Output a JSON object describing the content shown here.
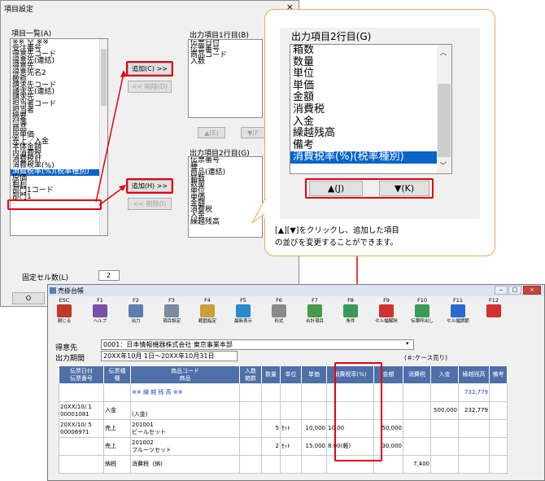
{
  "dialog": {
    "title": "項目設定",
    "close": "×",
    "item_list_label": "項目一覧(A)",
    "item_list": [
      "※※ 空 ※※",
      "受注番号",
      "得意先コード",
      "得意先(連結)",
      "得意先",
      "得意先名2",
      "敬称",
      "請求先コード",
      "請求先(連結)",
      "請求先",
      "担当者コード",
      "担当者",
      "摘要",
      "付箋",
      "商品",
      "原単価",
      "売上／入金",
      "本体金額",
      "内消費税",
      "消費税計",
      "消費税率(%)",
      "消費税率(%)(税率種別)",
      "原価",
      "粗利",
      "部門1コード",
      "部門1"
    ],
    "selected_item": "消費税率(%)(税率種別)",
    "add1": "追加(C) >>",
    "del1": "<< 削除(D)",
    "add2": "追加(H) >>",
    "del2": "<< 削除(I)",
    "out1_label": "出力項目1行目(B)",
    "out1_items": [
      "伝票日付",
      "伝票番号",
      "商品コード",
      "入数"
    ],
    "out1_up": "▲(E)",
    "out1_down": "▼(F",
    "out2_label": "出力項目2行目(G)",
    "out2_items": [
      "伝票番号",
      "種",
      "商品(連結)",
      "箱数",
      "数量",
      "単位",
      "単価",
      "金額",
      "消費税",
      "入金",
      "繰越残高"
    ],
    "fixed_label": "固定セル数(L)",
    "fixed_value": "2",
    "ok": "O"
  },
  "callout": {
    "heading": "出力項目2行目(G)",
    "items": [
      "箱数",
      "数量",
      "単位",
      "単価",
      "金額",
      "消費税",
      "入金",
      "繰越残高",
      "備考",
      "消費税率(%)(税率種別)"
    ],
    "selected": "消費税率(%)(税率種別)",
    "up": "▲(J)",
    "down": "▼(K)",
    "note1": "[▲][▼]をクリックし、追加した項目",
    "note2": "の並びを変更することができます。"
  },
  "main": {
    "title": "売掛台帳",
    "toolbar": [
      {
        "key": "ESC",
        "label": "閉じる",
        "icon": "close-icon",
        "color": "#c0392b"
      },
      {
        "key": "F1",
        "label": "ヘルプ",
        "icon": "help-icon",
        "color": "#7b4fa8"
      },
      {
        "key": "F2",
        "label": "出力",
        "icon": "output-icon",
        "color": "#5a7fb0"
      },
      {
        "key": "F3",
        "label": "項目設定",
        "icon": "item-settings-icon",
        "color": "#7a8aa0"
      },
      {
        "key": "F4",
        "label": "範囲指定",
        "icon": "range-icon",
        "color": "#c8a040"
      },
      {
        "key": "F5",
        "label": "最新表示",
        "icon": "refresh-icon",
        "color": "#2a8ad0"
      },
      {
        "key": "F6",
        "label": "形式",
        "icon": "format-icon",
        "color": "#8a8a8a"
      },
      {
        "key": "F7",
        "label": "合計項目",
        "icon": "total-icon",
        "color": "#4a9a4a"
      },
      {
        "key": "F8",
        "label": "条件",
        "icon": "filter-icon",
        "color": "#3a9a5a"
      },
      {
        "key": "F9",
        "label": "セル幅解除",
        "icon": "cell-width-icon",
        "color": "#d03030"
      },
      {
        "key": "F10",
        "label": "伝票呼出し",
        "icon": "voucher-icon",
        "color": "#3a9a5a"
      },
      {
        "key": "F11",
        "label": "セル幅調節",
        "icon": "adjust-icon",
        "color": "#2a6ad0"
      },
      {
        "key": "F12",
        "label": "",
        "icon": "cancel-icon",
        "color": "#d03030"
      }
    ],
    "customer_label": "得意先",
    "customer_value": "0001：日本情報機器株式会社 東京事業本部",
    "period_label": "出力期間",
    "period_value": "20XX年10月 1日〜20XX年10月31日",
    "case_note": "(＃:ケース売り)",
    "columns": [
      [
        "伝票日付",
        "伝票番号"
      ],
      [
        "伝票種",
        "種"
      ],
      [
        "商品コード",
        "商品"
      ],
      [
        "入数",
        "箱数"
      ],
      [
        "数量",
        ""
      ],
      [
        "単位",
        ""
      ],
      [
        "単価",
        ""
      ],
      [
        "消費税率(%)",
        ""
      ],
      [
        "金額",
        ""
      ],
      [
        "消費税",
        ""
      ],
      [
        "入金",
        ""
      ],
      [
        "繰越残高",
        ""
      ],
      [
        "備考",
        ""
      ]
    ],
    "rows": [
      [
        "",
        "",
        "※※ 繰 越 残 高 ※※",
        "",
        "",
        "",
        "",
        "",
        "",
        "",
        "",
        "732,779",
        ""
      ],
      [
        "20XX/10/ 1\n00001081",
        "入金",
        "\n(入金)",
        "",
        "",
        "",
        "",
        "",
        "",
        "",
        "500,000",
        "232,779",
        ""
      ],
      [
        "20XX/10/ 5\n00006971",
        "売上",
        "201001\nビールセット",
        "",
        "5",
        "ｾｯﾄ",
        "10,000",
        "10.00",
        "50,000",
        "",
        "",
        "",
        ""
      ],
      [
        "",
        "売上",
        "201002\nフルーツセット",
        "",
        "2",
        "ｾｯﾄ",
        "15,000",
        "8.00(軽)",
        "30,000",
        "",
        "",
        "",
        ""
      ],
      [
        "",
        "納税",
        "消費税  (納)",
        "",
        "",
        "",
        "",
        "",
        "",
        "7,400",
        "",
        "",
        ""
      ]
    ]
  }
}
